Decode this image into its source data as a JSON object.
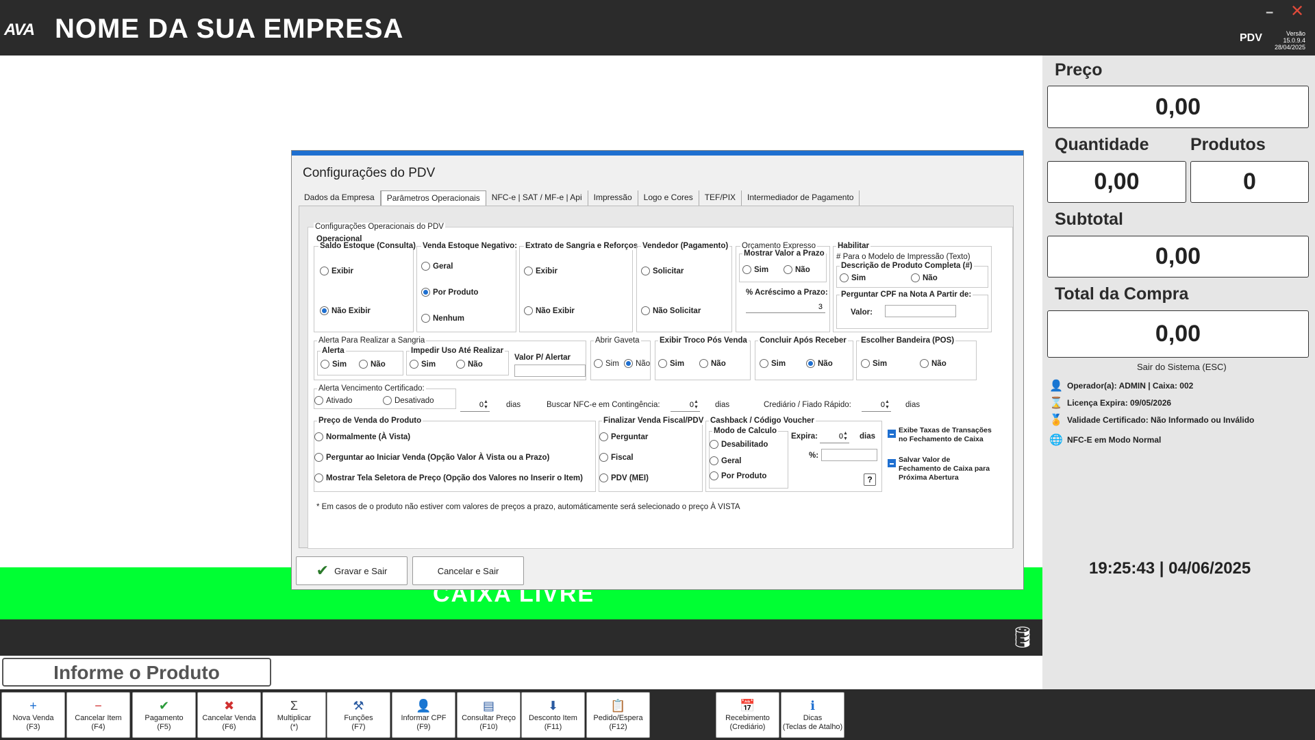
{
  "header": {
    "logo": "AVA",
    "company": "NOME DA SUA EMPRESA",
    "app_label": "PDV",
    "version_line1": "Versão 15.0.9.4",
    "version_line2": "28/04/2025",
    "minimize_icon": "window-minimize-icon",
    "close_icon": "window-close-icon"
  },
  "right_panel": {
    "price_label": "Preço",
    "price_value": "0,00",
    "qty_label": "Quantidade",
    "qty_value": "0,00",
    "products_label": "Produtos",
    "products_value": "0",
    "subtotal_label": "Subtotal",
    "subtotal_value": "0,00",
    "total_label": "Total da Compra",
    "total_value": "0,00",
    "exit_text": "Sair do Sistema (ESC)",
    "info": [
      {
        "icon": "operator-icon",
        "text": "Operador(a): ADMIN | Caixa: 002"
      },
      {
        "icon": "hourglass-icon",
        "text": "Licença Expira: 09/05/2026"
      },
      {
        "icon": "certificate-icon",
        "text": "Validade Certificado: Não Informado ou Inválido"
      },
      {
        "icon": "globe-icon",
        "text": "NFC-E em Modo Normal"
      }
    ],
    "clock": "19:25:43 | 04/06/2025"
  },
  "status": {
    "green_text": "CAIXA LIVRE",
    "product_input": "Informe o Produto"
  },
  "toolbar": [
    {
      "icon": "plus-icon",
      "l1": "Nova Venda",
      "l2": "(F3)",
      "color": "#1e6fd0",
      "glyph": "+"
    },
    {
      "icon": "minus-icon",
      "l1": "Cancelar Item",
      "l2": "(F4)",
      "color": "#d03030",
      "glyph": "−"
    },
    {
      "icon": "check-icon",
      "l1": "Pagamento",
      "l2": "(F5)",
      "color": "#2a9a3a",
      "glyph": "✔"
    },
    {
      "icon": "x-icon",
      "l1": "Cancelar Venda",
      "l2": "(F6)",
      "color": "#d03030",
      "glyph": "✖"
    },
    {
      "icon": "sigma-icon",
      "l1": "Multiplicar",
      "l2": "(*)",
      "color": "#444",
      "glyph": "Σ"
    },
    {
      "icon": "tools-icon",
      "l1": "Funções",
      "l2": "(F7)",
      "color": "#2a5aa0",
      "glyph": "⚒"
    },
    {
      "icon": "user-icon",
      "l1": "Informar CPF",
      "l2": "(F9)",
      "color": "#2a5aa0",
      "glyph": "👤"
    },
    {
      "icon": "barcode-icon",
      "l1": "Consultar Preço",
      "l2": "(F10)",
      "color": "#2a5aa0",
      "glyph": "▤"
    },
    {
      "icon": "arrow-down-icon",
      "l1": "Desconto Item",
      "l2": "(F11)",
      "color": "#2a5aa0",
      "glyph": "⬇"
    },
    {
      "icon": "clipboard-icon",
      "l1": "Pedido/Espera",
      "l2": "(F12)",
      "color": "#b08a20",
      "glyph": "📋"
    },
    {
      "icon": "calendar-icon",
      "l1": "Recebimento",
      "l2": "(Crediário)",
      "color": "#c03030",
      "glyph": "📅"
    },
    {
      "icon": "info-icon",
      "l1": "Dicas",
      "l2": "(Teclas de Atalho)",
      "color": "#1e6fd0",
      "glyph": "ℹ"
    }
  ],
  "dialog": {
    "title": "Configurações do PDV",
    "tabs": [
      "Dados da Empresa",
      "Parâmetros Operacionais",
      "NFC-e | SAT / MF-e | Api",
      "Impressão",
      "Logo e Cores",
      "TEF/PIX",
      "Intermediador de Pagamento"
    ],
    "section_title": "Configurações Operacionais do PDV",
    "operacional": "Operacional",
    "saldo": {
      "title": "Saldo Estoque (Consulta)",
      "opt1": "Exibir",
      "opt2": "Não Exibir"
    },
    "venda_neg": {
      "title": "Venda Estoque Negativo:",
      "opt1": "Geral",
      "opt2": "Por Produto",
      "opt3": "Nenhum"
    },
    "extrato": {
      "title": "Extrato de Sangria e Reforços",
      "opt1": "Exibir",
      "opt2": "Não Exibir"
    },
    "vendedor": {
      "title": "Vendedor (Pagamento)",
      "opt1": "Solicitar",
      "opt2": "Não Solicitar"
    },
    "orcamento": {
      "title": "Orçamento Expresso",
      "sub": "Mostrar Valor a Prazo",
      "sim": "Sim",
      "nao": "Não",
      "acrescimo_label": "% Acréscimo a Prazo:",
      "acrescimo_value": "3"
    },
    "habilitar": {
      "title": "Habilitar",
      "note": "# Para o Modelo de Impressão (Texto)",
      "desc_title": "Descrição de Produto Completa (#)",
      "sim": "Sim",
      "nao": "Não",
      "cpf_title": "Perguntar CPF na Nota A Partir de:",
      "valor_label": "Valor:",
      "valor_value": ""
    },
    "alerta_sangria": {
      "title": "Alerta Para Realizar a Sangria",
      "alerta": "Alerta",
      "impedir": "Impedir Uso Até Realizar",
      "valor_alertar": "Valor P/ Alertar",
      "sim": "Sim",
      "nao": "Não"
    },
    "abrir_gaveta": {
      "title": "Abrir Gaveta",
      "sim": "Sim",
      "nao": "Não"
    },
    "troco": {
      "title": "Exibir Troco Pós Venda",
      "sim": "Sim",
      "nao": "Não"
    },
    "concluir": {
      "title": "Concluir  Após Receber",
      "sim": "Sim",
      "nao": "Não"
    },
    "bandeira": {
      "title": "Escolher Bandeira (POS)",
      "sim": "Sim",
      "nao": "Não"
    },
    "certificado": {
      "title": "Alerta Vencimento Certificado:",
      "ativado": "Ativado",
      "desativado": "Desativado",
      "dias_value": "0",
      "dias": "dias"
    },
    "contingencia": {
      "label": "Buscar NFC-e em Contingência:",
      "value": "0",
      "dias": "dias"
    },
    "crediario": {
      "label": "Crediário / Fiado Rápido:",
      "value": "0",
      "dias": "dias"
    },
    "preco_venda": {
      "title": "Preço de Venda do Produto",
      "opt1": "Normalmente (À Vista)",
      "opt2": "Perguntar ao Iniciar Venda (Opção Valor À Vista ou a Prazo)",
      "opt3": "Mostrar Tela Seletora de Preço (Opção dos Valores no Inserir o Item)"
    },
    "finalizar": {
      "title": "Finalizar Venda Fiscal/PDV",
      "opt1": "Perguntar",
      "opt2": "Fiscal",
      "opt3": "PDV (MEI)"
    },
    "cashback": {
      "title": "Cashback / Código Voucher",
      "modo": "Modo de Calculo",
      "opt1": "Desabilitado",
      "opt2": "Geral",
      "opt3": "Por Produto",
      "expira_label": "Expira:",
      "expira_value": "0",
      "dias": "dias",
      "pct_label": "%:",
      "pct_value": "",
      "help": "?"
    },
    "exibe_taxas_1": "Exibe Taxas de Transações",
    "exibe_taxas_2": "no Fechamento de Caixa",
    "salvar_1": "Salvar Valor de",
    "salvar_2": "Fechamento de Caixa para",
    "salvar_3": "Próxima Abertura",
    "footnote": "* Em casos de o produto não estiver com valores de preços a prazo, automáticamente será selecionado o preço À VISTA",
    "btn_save": "Gravar e Sair",
    "btn_cancel": "Cancelar e Sair"
  }
}
